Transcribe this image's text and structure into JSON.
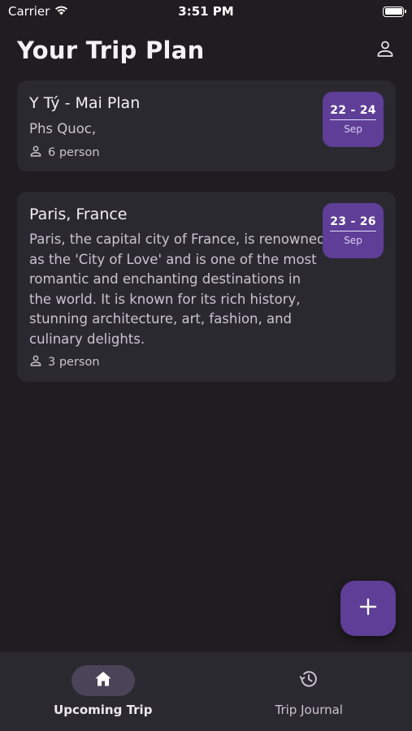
{
  "status_bar": {
    "carrier": "Carrier",
    "time": "3:51 PM"
  },
  "header": {
    "title": "Your Trip Plan",
    "profile_icon": "person-outline-icon"
  },
  "trips": [
    {
      "title": "Y Tý - Mai Plan",
      "description": "Phs Quoc,",
      "people": "6 person",
      "date_range": "22 - 24",
      "month": "Sep"
    },
    {
      "title": "Paris, France",
      "description": "Paris, the capital city of France, is renowned as the 'City of Love' and is one of the most romantic and enchanting destinations in the world. It is known for its rich history, stunning architecture, art, fashion, and culinary delights.",
      "people": "3 person",
      "date_range": "23 - 26",
      "month": "Sep"
    }
  ],
  "fab": {
    "icon": "plus-icon"
  },
  "bottom_nav": {
    "items": [
      {
        "label": "Upcoming Trip",
        "icon": "home-icon",
        "active": true
      },
      {
        "label": "Trip Journal",
        "icon": "history-icon",
        "active": false
      }
    ]
  },
  "colors": {
    "background": "#1f1d21",
    "card": "#2b2930",
    "accent": "#5e3e96",
    "nav_pill": "#4a4458"
  }
}
